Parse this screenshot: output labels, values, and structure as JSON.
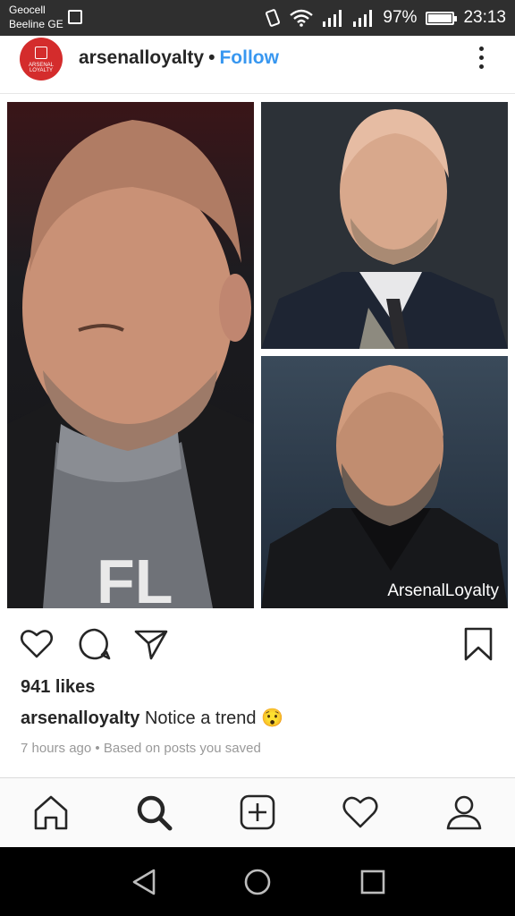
{
  "status_bar": {
    "carrier_1": "Geocell",
    "carrier_2": "Beeline GE",
    "battery_percent": "97%",
    "battery_level": 0.97,
    "time": "23:13"
  },
  "post": {
    "username": "arsenalloyalty",
    "dot": "•",
    "follow_label": "Follow",
    "avatar_text": "ARSENAL LOYALTY",
    "watermark": "ArsenalLoyalty",
    "likes": "941 likes",
    "caption_user": "arsenalloyalty",
    "caption_text": "Notice a trend",
    "caption_emoji": "😯",
    "time_ago": "7 hours ago",
    "meta_separator": "•",
    "meta_reason": "Based on posts you saved"
  },
  "icons": {
    "like": "heart-icon",
    "comment": "comment-icon",
    "share": "send-icon",
    "save": "bookmark-icon",
    "nav_home": "home-icon",
    "nav_search": "search-icon",
    "nav_new_post": "add-post-icon",
    "nav_activity": "heart-icon",
    "nav_profile": "profile-icon"
  },
  "colors": {
    "follow": "#3897f0",
    "avatar": "#d42c2c",
    "text": "#262626",
    "meta": "#999999"
  }
}
